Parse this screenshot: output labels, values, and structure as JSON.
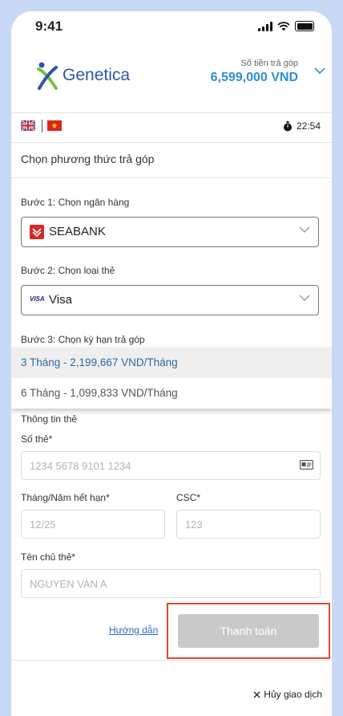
{
  "status_bar": {
    "time": "9:41"
  },
  "header": {
    "brand": "Genetica",
    "amount_label": "Số tiền trả góp",
    "amount_value": "6,599,000 VND"
  },
  "timer": {
    "value": "22:54"
  },
  "section_title": "Chọn phương thức trả góp",
  "step1": {
    "label": "Bước 1: Chọn ngân hàng",
    "bank": "SEABANK"
  },
  "step2": {
    "label": "Bước 2: Chọn loại thẻ",
    "card_logo": "VISA",
    "card_type": "Visa"
  },
  "step3": {
    "label": "Bước 3: Chọn kỳ hạn trả góp",
    "options": [
      "3 Tháng - 2,199,667 VND/Tháng",
      "6 Tháng - 1,099,833 VND/Tháng"
    ],
    "selected_index": 0
  },
  "card_info": {
    "title": "Thông tin thẻ",
    "card_number_label": "Số thẻ*",
    "card_number_placeholder": "1234 5678 9101 1234",
    "expiry_label": "Tháng/Năm hết hạn*",
    "expiry_placeholder": "12/25",
    "csc_label": "CSC*",
    "csc_placeholder": "123",
    "holder_label": "Tên chủ thẻ*",
    "holder_placeholder": "NGUYEN VAN A"
  },
  "actions": {
    "help": "Hướng dẫn",
    "pay": "Thanh toán",
    "cancel": "Hủy giao dịch"
  },
  "colors": {
    "brand_blue": "#2d57a6",
    "amount_blue": "#2d8fd5",
    "highlight_red": "#e04a2f",
    "disabled_button": "#c9c9c9"
  },
  "icons": [
    "signal-icon",
    "wifi-icon",
    "battery-icon",
    "chevron-down-icon",
    "uk-flag-icon",
    "vn-flag-icon",
    "stopwatch-icon",
    "card-icon",
    "close-icon"
  ]
}
